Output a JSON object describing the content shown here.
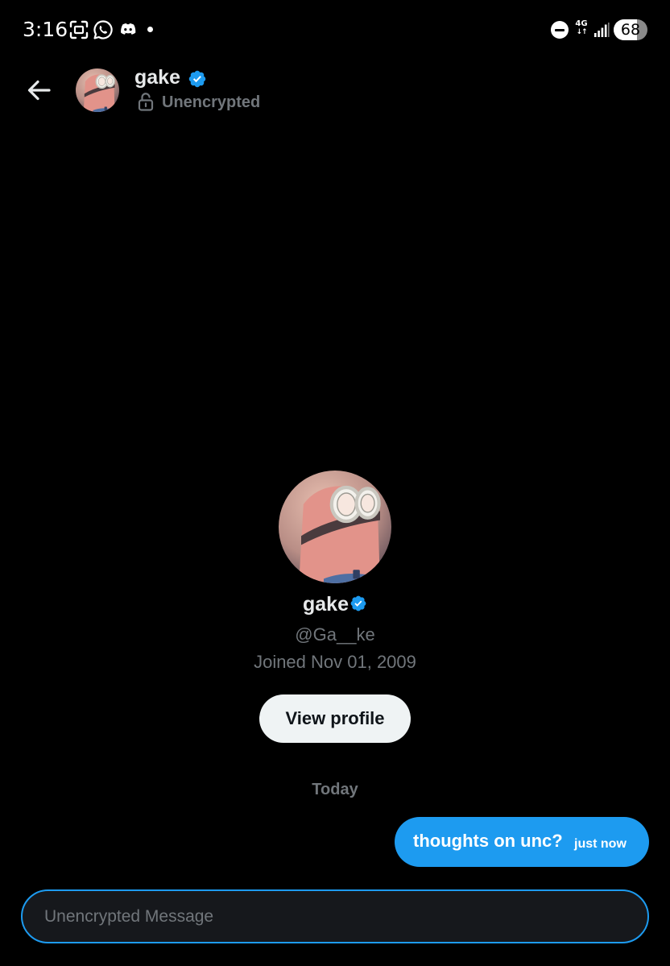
{
  "status_bar": {
    "time": "3:16",
    "network": "4G",
    "battery": "68",
    "battery_level": 0.68
  },
  "header": {
    "back_icon": "arrow-left-icon",
    "name": "gake",
    "encryption": "Unencrypted"
  },
  "profile": {
    "name": "gake",
    "handle": "@Ga__ke",
    "joined": "Joined Nov 01, 2009",
    "view_profile_label": "View profile"
  },
  "conversation": {
    "day_label": "Today",
    "messages": [
      {
        "text": "thoughts on unc?",
        "time": "just now",
        "outgoing": true
      }
    ]
  },
  "composer": {
    "placeholder": "Unencrypted Message"
  },
  "colors": {
    "background": "#000000",
    "accent": "#1d9bf0",
    "muted_text": "#71767b",
    "primary_text": "#e7e9ea"
  }
}
